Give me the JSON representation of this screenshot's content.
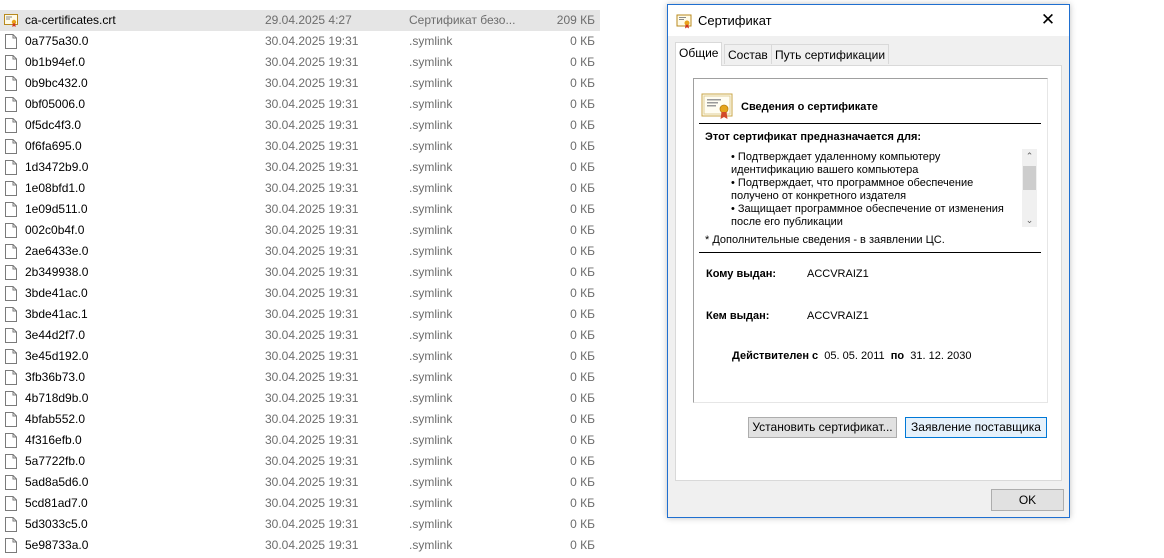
{
  "files": [
    {
      "name": "ca-certificates.crt",
      "date": "29.04.2025 4:27",
      "type": "Сертификат безо...",
      "size": "209 КБ",
      "icon": "certificate-file-icon",
      "selected": true
    },
    {
      "name": "0a775a30.0",
      "date": "30.04.2025 19:31",
      "type": ".symlink",
      "size": "0 КБ",
      "icon": "file-icon"
    },
    {
      "name": "0b1b94ef.0",
      "date": "30.04.2025 19:31",
      "type": ".symlink",
      "size": "0 КБ",
      "icon": "file-icon"
    },
    {
      "name": "0b9bc432.0",
      "date": "30.04.2025 19:31",
      "type": ".symlink",
      "size": "0 КБ",
      "icon": "file-icon"
    },
    {
      "name": "0bf05006.0",
      "date": "30.04.2025 19:31",
      "type": ".symlink",
      "size": "0 КБ",
      "icon": "file-icon"
    },
    {
      "name": "0f5dc4f3.0",
      "date": "30.04.2025 19:31",
      "type": ".symlink",
      "size": "0 КБ",
      "icon": "file-icon"
    },
    {
      "name": "0f6fa695.0",
      "date": "30.04.2025 19:31",
      "type": ".symlink",
      "size": "0 КБ",
      "icon": "file-icon"
    },
    {
      "name": "1d3472b9.0",
      "date": "30.04.2025 19:31",
      "type": ".symlink",
      "size": "0 КБ",
      "icon": "file-icon"
    },
    {
      "name": "1e08bfd1.0",
      "date": "30.04.2025 19:31",
      "type": ".symlink",
      "size": "0 КБ",
      "icon": "file-icon"
    },
    {
      "name": "1e09d511.0",
      "date": "30.04.2025 19:31",
      "type": ".symlink",
      "size": "0 КБ",
      "icon": "file-icon"
    },
    {
      "name": "002c0b4f.0",
      "date": "30.04.2025 19:31",
      "type": ".symlink",
      "size": "0 КБ",
      "icon": "file-icon"
    },
    {
      "name": "2ae6433e.0",
      "date": "30.04.2025 19:31",
      "type": ".symlink",
      "size": "0 КБ",
      "icon": "file-icon"
    },
    {
      "name": "2b349938.0",
      "date": "30.04.2025 19:31",
      "type": ".symlink",
      "size": "0 КБ",
      "icon": "file-icon"
    },
    {
      "name": "3bde41ac.0",
      "date": "30.04.2025 19:31",
      "type": ".symlink",
      "size": "0 КБ",
      "icon": "file-icon"
    },
    {
      "name": "3bde41ac.1",
      "date": "30.04.2025 19:31",
      "type": ".symlink",
      "size": "0 КБ",
      "icon": "file-icon"
    },
    {
      "name": "3e44d2f7.0",
      "date": "30.04.2025 19:31",
      "type": ".symlink",
      "size": "0 КБ",
      "icon": "file-icon"
    },
    {
      "name": "3e45d192.0",
      "date": "30.04.2025 19:31",
      "type": ".symlink",
      "size": "0 КБ",
      "icon": "file-icon"
    },
    {
      "name": "3fb36b73.0",
      "date": "30.04.2025 19:31",
      "type": ".symlink",
      "size": "0 КБ",
      "icon": "file-icon"
    },
    {
      "name": "4b718d9b.0",
      "date": "30.04.2025 19:31",
      "type": ".symlink",
      "size": "0 КБ",
      "icon": "file-icon"
    },
    {
      "name": "4bfab552.0",
      "date": "30.04.2025 19:31",
      "type": ".symlink",
      "size": "0 КБ",
      "icon": "file-icon"
    },
    {
      "name": "4f316efb.0",
      "date": "30.04.2025 19:31",
      "type": ".symlink",
      "size": "0 КБ",
      "icon": "file-icon"
    },
    {
      "name": "5a7722fb.0",
      "date": "30.04.2025 19:31",
      "type": ".symlink",
      "size": "0 КБ",
      "icon": "file-icon"
    },
    {
      "name": "5ad8a5d6.0",
      "date": "30.04.2025 19:31",
      "type": ".symlink",
      "size": "0 КБ",
      "icon": "file-icon"
    },
    {
      "name": "5cd81ad7.0",
      "date": "30.04.2025 19:31",
      "type": ".symlink",
      "size": "0 КБ",
      "icon": "file-icon"
    },
    {
      "name": "5d3033c5.0",
      "date": "30.04.2025 19:31",
      "type": ".symlink",
      "size": "0 КБ",
      "icon": "file-icon"
    },
    {
      "name": "5e98733a.0",
      "date": "30.04.2025 19:31",
      "type": ".symlink",
      "size": "0 КБ",
      "icon": "file-icon"
    }
  ],
  "dialog": {
    "title": "Сертификат",
    "title_icon": "certificate-icon",
    "close_label": "✕",
    "tabs": [
      {
        "label": "Общие",
        "active": true
      },
      {
        "label": "Состав",
        "active": false
      },
      {
        "label": "Путь сертификации",
        "active": false
      }
    ],
    "info": {
      "heading": "Сведения о сертификате",
      "purpose_title": "Этот сертификат предназначается для:",
      "purposes": [
        "• Подтверждает удаленному компьютеру идентификацию вашего компьютера",
        "• Подтверждает, что программное обеспечение получено от конкретного издателя",
        "• Защищает программное обеспечение от  изменения после его публикации"
      ],
      "note": "* Дополнительные сведения - в заявлении ЦС.",
      "issued_to_label": "Кому выдан:",
      "issued_to_value": "ACCVRAIZ1",
      "issued_by_label": "Кем выдан:",
      "issued_by_value": "ACCVRAIZ1",
      "valid_from_label": "Действителен с",
      "valid_from": "05. 05. 2011",
      "valid_to_label": "по",
      "valid_to": "31. 12. 2030"
    },
    "install_button": "Установить сертификат...",
    "issuer_statement_button": "Заявление поставщика",
    "ok_button": "OK",
    "colors": {
      "accent": "#0078d7",
      "border": "#1f6fd0"
    }
  }
}
